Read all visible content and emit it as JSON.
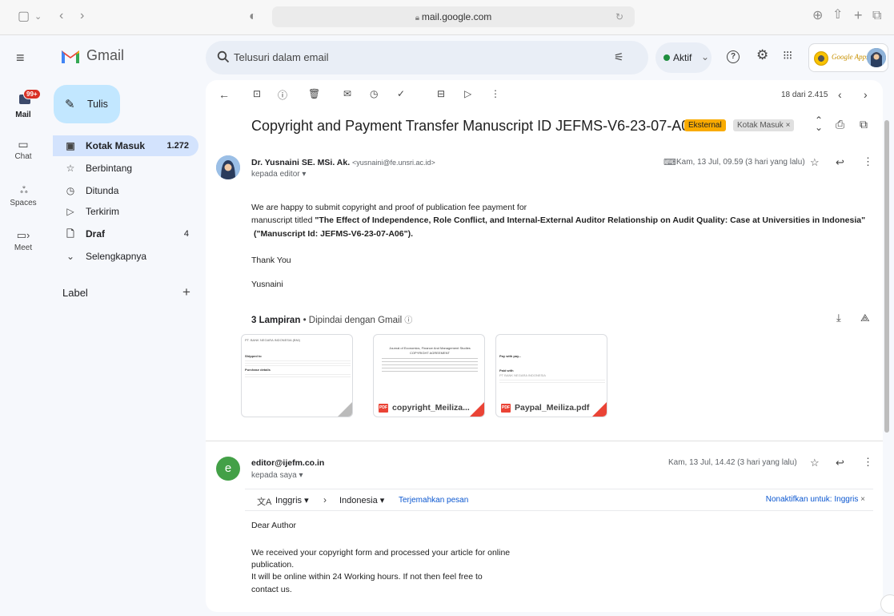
{
  "browser": {
    "url": "mail.google.com"
  },
  "app": {
    "name": "Gmail"
  },
  "search": {
    "placeholder": "Telusuri dalam email"
  },
  "status": {
    "label": "Aktif"
  },
  "brand_badge": {
    "text": "Google Apps"
  },
  "rail": {
    "badge": "99+",
    "items": [
      {
        "label": "Mail"
      },
      {
        "label": "Chat"
      },
      {
        "label": "Spaces"
      },
      {
        "label": "Meet"
      }
    ]
  },
  "compose": {
    "label": "Tulis"
  },
  "nav": {
    "items": [
      {
        "label": "Kotak Masuk",
        "count": "1.272"
      },
      {
        "label": "Berbintang",
        "count": ""
      },
      {
        "label": "Ditunda",
        "count": ""
      },
      {
        "label": "Terkirim",
        "count": ""
      },
      {
        "label": "Draf",
        "count": "4"
      },
      {
        "label": "Selengkapnya",
        "count": ""
      }
    ],
    "labels_heading": "Label"
  },
  "toolbar": {
    "pager": "18 dari 2.415"
  },
  "thread": {
    "subject": "Copyright and Payment Transfer Manuscript ID JEFMS-V6-23-07-A06",
    "tags": [
      {
        "text": "Eksternal"
      },
      {
        "text": "Kotak Masuk ×"
      }
    ],
    "messages": [
      {
        "sender_name": "Dr. Yusnaini SE. MSi. Ak.",
        "sender_email": "<yusnaini@fe.unsri.ac.id>",
        "to": "kepada editor",
        "date": "Kam, 13 Jul, 09.59 (3 hari yang lalu)",
        "body": {
          "line1": "We are happy to submit copyright and proof of publication fee payment for",
          "line2_prefix": "manuscript titled ",
          "line2_title": "\"The Effect of Independence, Role Conflict, and Internal-External Auditor Relationship on Audit Quality: Case at Universities in Indonesia\"",
          "line3": "(\"Manuscript Id: JEFMS-V6-23-07-A06\").",
          "thanks": "Thank You",
          "sign": "Yusnaini"
        },
        "attachments_heading": "3 Lampiran",
        "attachments_scan": "Dipindai dengan Gmail",
        "attachments": [
          {
            "name": "",
            "preview": [
              "PT. BANK NEGARA INDONESIA (BNI)",
              "Shipped to",
              "Purchase details"
            ]
          },
          {
            "name": "copyright_Meiliza...",
            "preview": [
              "Journal of Economics, Finance And Management Studies",
              "COPYRIGHT AGREEMENT"
            ]
          },
          {
            "name": "Paypal_Meiliza.pdf",
            "preview": [
              "Pay with pay...",
              "Paid with",
              "PT BANK NEGARA INDONESIA"
            ]
          }
        ]
      },
      {
        "avatar_letter": "e",
        "sender_name": "editor@ijefm.co.in",
        "to": "kepada saya",
        "date": "Kam, 13 Jul, 14.42 (3 hari yang lalu)",
        "translate": {
          "from": "Inggris",
          "to": "Indonesia",
          "action": "Terjemahkan pesan",
          "disable": "Nonaktifkan untuk: Inggris"
        },
        "body": {
          "greeting": "Dear Author",
          "line1": "We received your copyright form and processed your article for online",
          "line2": "publication.",
          "line3": "It will be online within 24 Working hours. If not then feel free to",
          "line4": "contact us."
        }
      }
    ]
  },
  "colors": {
    "accent": "#0b57d0",
    "compose_bg": "#c2e7ff",
    "selected_nav": "#d3e3fd",
    "external_tag": "#f9ab00",
    "avatar_e": "#43a047"
  }
}
